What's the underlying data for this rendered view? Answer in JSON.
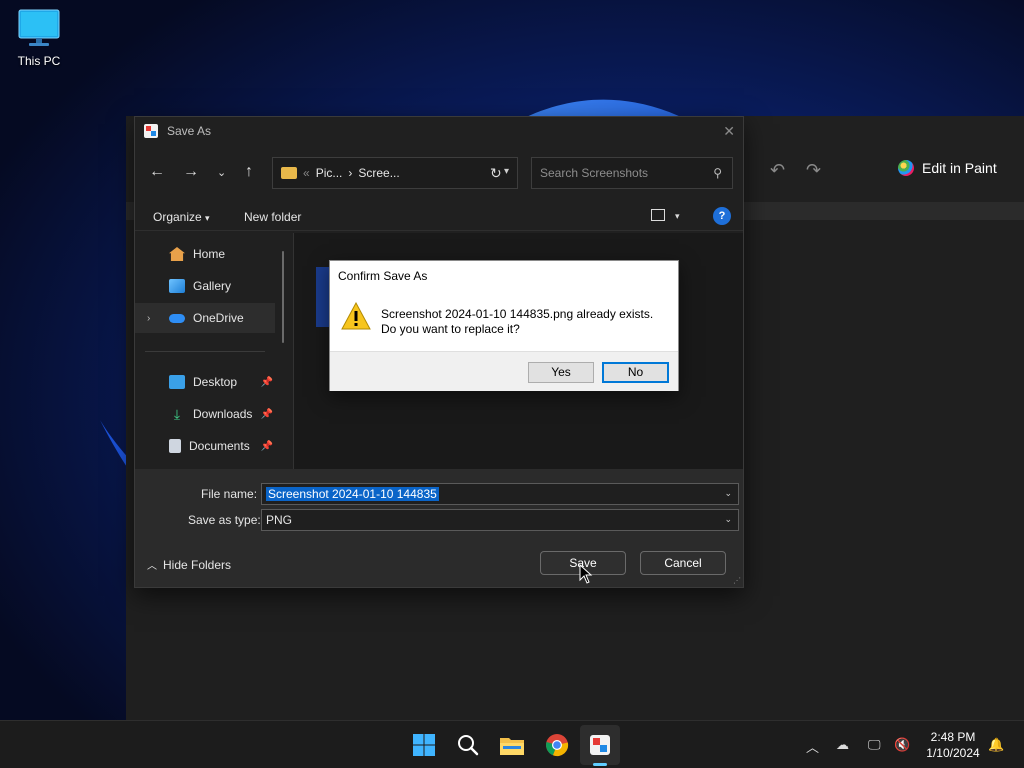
{
  "desktop": {
    "this_pc_label": "This PC"
  },
  "background_app": {
    "edit_in_paint_label": "Edit in Paint"
  },
  "save_as": {
    "title": "Save As",
    "address_parts": [
      "Pic...",
      "Scree..."
    ],
    "address_separator": "«",
    "address_chevron": "›",
    "search_placeholder": "Search Screenshots",
    "organize_label": "Organize",
    "new_folder_label": "New folder",
    "nav_items": [
      {
        "label": "Home",
        "icon": "home-icon"
      },
      {
        "label": "Gallery",
        "icon": "gallery-icon"
      },
      {
        "label": "OneDrive",
        "icon": "onedrive-icon"
      },
      {
        "label": "Desktop",
        "icon": "desktop-icon",
        "pinned": true
      },
      {
        "label": "Downloads",
        "icon": "downloads-icon",
        "pinned": true
      },
      {
        "label": "Documents",
        "icon": "documents-icon",
        "pinned": true
      }
    ],
    "file_name_label": "File name:",
    "file_name_value": "Screenshot 2024-01-10 144835",
    "save_type_label": "Save as type:",
    "save_type_value": "PNG",
    "hide_folders_label": "Hide Folders",
    "save_label": "Save",
    "cancel_label": "Cancel"
  },
  "confirm": {
    "title": "Confirm Save As",
    "message_line1": "Screenshot 2024-01-10 144835.png already exists.",
    "message_line2": "Do you want to replace it?",
    "yes_label": "Yes",
    "no_label": "No"
  },
  "taskbar": {
    "time": "2:48 PM",
    "date": "1/10/2024",
    "apps": [
      "start-icon",
      "search-icon",
      "file-explorer-icon",
      "chrome-icon",
      "snipping-tool-icon"
    ]
  },
  "colors": {
    "accent": "#0078d7",
    "selection": "#0a64c8",
    "folder": "#e8b84a"
  }
}
